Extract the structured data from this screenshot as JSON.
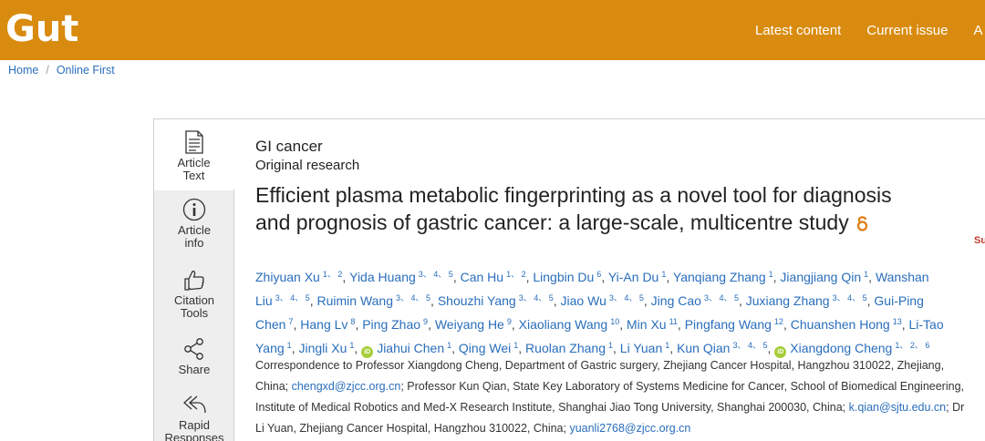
{
  "header": {
    "logo": "Gut",
    "nav": [
      "Latest content",
      "Current issue",
      "A"
    ]
  },
  "breadcrumb": [
    "Home",
    "Online First"
  ],
  "sidebar": [
    {
      "label_line1": "Article",
      "label_line2": "Text",
      "icon": "document-icon"
    },
    {
      "label_line1": "Article",
      "label_line2": "info",
      "icon": "info-icon"
    },
    {
      "label_line1": "Citation",
      "label_line2": "Tools",
      "icon": "thumbs-up-icon"
    },
    {
      "label_line1": "Share",
      "label_line2": "",
      "icon": "share-icon"
    },
    {
      "label_line1": "Rapid",
      "label_line2": "Responses",
      "icon": "reply-all-icon"
    }
  ],
  "article": {
    "subject": "GI cancer",
    "type": "Original research",
    "title_line1": "Efficient plasma metabolic fingerprinting as a novel tool for diagnosis",
    "title_line2": "and prognosis of gastric cancer: a large-scale, multicentre study",
    "side_label": "Su"
  },
  "authors": [
    [
      {
        "name": "Zhiyuan Xu",
        "sup": "1, 2"
      },
      {
        "name": "Yida Huang",
        "sup": "3, 4, 5"
      },
      {
        "name": "Can Hu",
        "sup": "1, 2"
      },
      {
        "name": "Lingbin Du",
        "sup": "6"
      },
      {
        "name": "Yi-An Du",
        "sup": "1"
      },
      {
        "name": "Yanqiang Zhang",
        "sup": "1"
      },
      {
        "name": "Jiangjiang Qin",
        "sup": "1"
      },
      {
        "name": "Wanshan",
        "sup": ""
      }
    ],
    [
      {
        "name": "Liu",
        "sup": "3, 4, 5"
      },
      {
        "name": "Ruimin Wang",
        "sup": "3, 4, 5"
      },
      {
        "name": "Shouzhi Yang",
        "sup": "3, 4, 5"
      },
      {
        "name": "Jiao Wu",
        "sup": "3, 4, 5"
      },
      {
        "name": "Jing Cao",
        "sup": "3, 4, 5"
      },
      {
        "name": "Juxiang Zhang",
        "sup": "3, 4, 5"
      },
      {
        "name": "Gui-Ping",
        "sup": ""
      }
    ],
    [
      {
        "name": "Chen",
        "sup": "7"
      },
      {
        "name": "Hang Lv",
        "sup": "8"
      },
      {
        "name": "Ping Zhao",
        "sup": "9"
      },
      {
        "name": "Weiyang He",
        "sup": "9"
      },
      {
        "name": "Xiaoliang Wang",
        "sup": "10"
      },
      {
        "name": "Min Xu",
        "sup": "11"
      },
      {
        "name": "Pingfang Wang",
        "sup": "12"
      },
      {
        "name": "Chuanshen Hong",
        "sup": "13"
      },
      {
        "name": "Li-Tao",
        "sup": ""
      }
    ],
    [
      {
        "name": "Yang",
        "sup": "1"
      },
      {
        "name": "Jingli Xu",
        "sup": "1"
      },
      {
        "name": "Jiahui Chen",
        "sup": "1",
        "orcid": true
      },
      {
        "name": "Qing Wei",
        "sup": "1"
      },
      {
        "name": "Ruolan Zhang",
        "sup": "1"
      },
      {
        "name": "Li Yuan",
        "sup": "1"
      },
      {
        "name": "Kun Qian",
        "sup": "3, 4, 5"
      },
      {
        "name": "Xiangdong Cheng",
        "sup": "1, 2, 6",
        "orcid": true
      }
    ]
  ],
  "orcid_label": "iD",
  "correspondence": [
    [
      {
        "t": "Correspondence to Professor Xiangdong Cheng, Department of Gastric surgery, Zhejiang Cancer Hospital, Hangzhou 310022, Zhejiang,"
      }
    ],
    [
      {
        "t": "China; "
      },
      {
        "t": "chengxd@zjcc.org.cn",
        "email": true
      },
      {
        "t": "; Professor Kun Qian, State Key Laboratory of Systems Medicine for Cancer, School of Biomedical Engineering,"
      }
    ],
    [
      {
        "t": "Institute of Medical Robotics and Med-X Research Institute, Shanghai Jiao Tong University, Shanghai 200030, China; "
      },
      {
        "t": "k.qian@sjtu.edu.cn",
        "email": true
      },
      {
        "t": "; Dr"
      }
    ],
    [
      {
        "t": "Li Yuan, Zhejiang Cancer Hospital, Hangzhou 310022, China; "
      },
      {
        "t": "yuanli2768@zjcc.org.cn",
        "email": true
      }
    ]
  ]
}
